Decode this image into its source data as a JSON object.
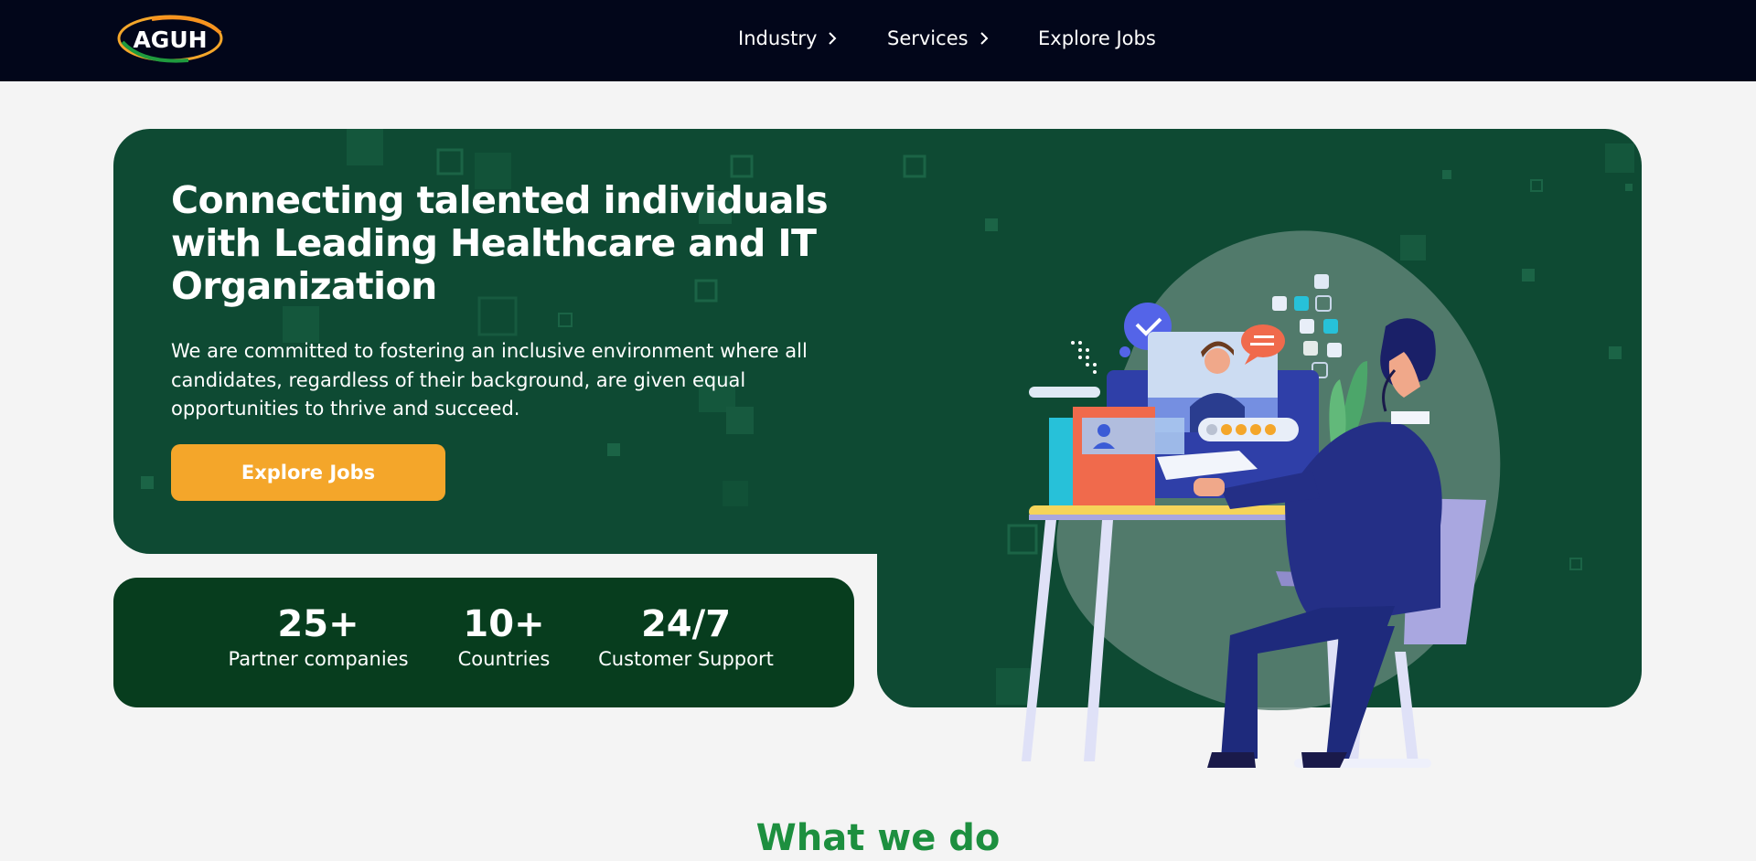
{
  "nav": {
    "logo_text": "AGUH",
    "items": [
      {
        "label": "Industry",
        "has_submenu": true
      },
      {
        "label": "Services",
        "has_submenu": true
      },
      {
        "label": "Explore Jobs",
        "has_submenu": false
      }
    ]
  },
  "hero": {
    "title": "Connecting talented individuals with Leading Healthcare and IT Organization",
    "description": "We are committed to fostering an inclusive environment where all candidates, regardless of their background, are given equal opportunities to thrive and succeed.",
    "cta_label": "Explore Jobs"
  },
  "stats": [
    {
      "value": "25+",
      "label": "Partner companies"
    },
    {
      "value": "10+",
      "label": "Countries"
    },
    {
      "value": "24/7",
      "label": "Customer Support"
    }
  ],
  "section": {
    "title": "What we do"
  },
  "colors": {
    "navbar": "#02061a",
    "hero_bg": "#0e4a33",
    "stats_bg": "#073d1e",
    "cta": "#f4a62a",
    "section_title": "#1d8f3f",
    "page_bg": "#f4f4f4"
  }
}
